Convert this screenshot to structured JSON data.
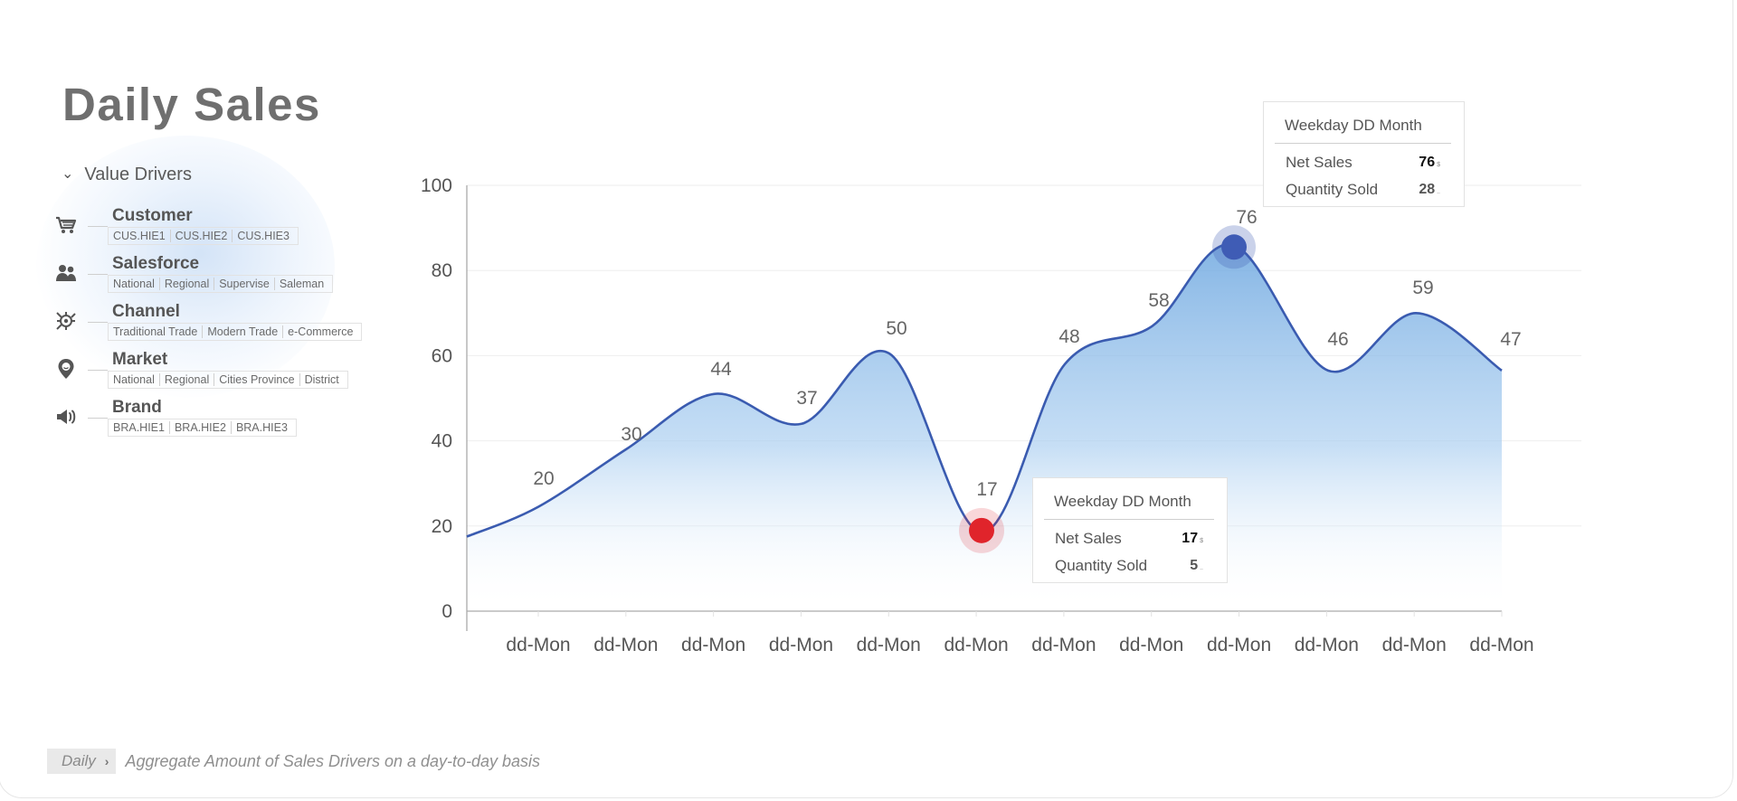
{
  "page": {
    "title": "Daily Sales"
  },
  "value_drivers": {
    "label": "Value Drivers",
    "items": [
      {
        "name": "Customer",
        "icon": "cart-icon",
        "tags": [
          "CUS.HIE1",
          "CUS.HIE2",
          "CUS.HIE3"
        ]
      },
      {
        "name": "Salesforce",
        "icon": "people-icon",
        "tags": [
          "National",
          "Regional",
          "Supervise",
          "Saleman"
        ]
      },
      {
        "name": "Channel",
        "icon": "channel-icon",
        "tags": [
          "Traditional Trade",
          "Modern Trade",
          "e-Commerce"
        ]
      },
      {
        "name": "Market",
        "icon": "location-pin-icon",
        "tags": [
          "National",
          "Regional",
          "Cities Province",
          "District"
        ]
      },
      {
        "name": "Brand",
        "icon": "megaphone-icon",
        "tags": [
          "BRA.HIE1",
          "BRA.HIE2",
          "BRA.HIE3"
        ]
      }
    ]
  },
  "chart_data": {
    "type": "area",
    "categories": [
      "dd-Mon",
      "dd-Mon",
      "dd-Mon",
      "dd-Mon",
      "dd-Mon",
      "dd-Mon",
      "dd-Mon",
      "dd-Mon",
      "dd-Mon",
      "dd-Mon",
      "dd-Mon",
      "dd-Mon"
    ],
    "values": [
      20,
      30,
      44,
      37,
      50,
      17,
      48,
      58,
      76,
      46,
      59,
      47
    ],
    "ylim": [
      0,
      100
    ],
    "yticks": [
      0,
      20,
      40,
      60,
      80,
      100
    ],
    "grid": true,
    "line_color": "#3a5bb0",
    "fill_color": "#7fb3e6",
    "highlight_low": {
      "index": 5,
      "color": "#e0242b"
    },
    "highlight_high": {
      "index": 8,
      "color": "#3f5cb5"
    }
  },
  "tooltips": [
    {
      "id": "high",
      "header": "Weekday DD Month",
      "net_sales_label": "Net Sales",
      "net_sales_value": "76",
      "qty_label": "Quantity Sold",
      "qty_value": "28"
    },
    {
      "id": "low",
      "header": "Weekday DD Month",
      "net_sales_label": "Net Sales",
      "net_sales_value": "17",
      "qty_label": "Quantity Sold",
      "qty_value": "5"
    }
  ],
  "footer": {
    "crumb": "Daily",
    "description": "Aggregate Amount of Sales Drivers on a day-to-day basis"
  }
}
